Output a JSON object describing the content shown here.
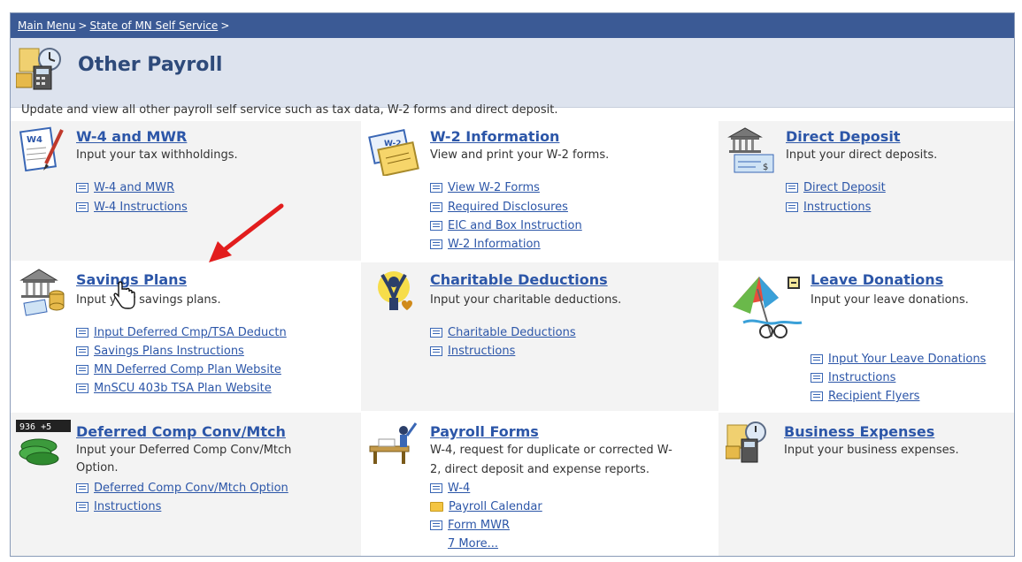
{
  "breadcrumb": {
    "main_menu": "Main Menu",
    "self_service": "State of MN Self Service",
    "sep": ">"
  },
  "page": {
    "title": "Other Payroll",
    "intro": "Update and view all other payroll self service such as tax data, W-2 forms and direct deposit."
  },
  "sections": {
    "w4": {
      "title": "W-4 and MWR",
      "description": "Input your tax withholdings.",
      "links": [
        "W-4 and MWR",
        "W-4 Instructions"
      ]
    },
    "w2": {
      "title": "W-2 Information",
      "description": "View and print your W-2 forms.",
      "links": [
        "View W-2 Forms",
        "Required Disclosures",
        "EIC and Box Instruction",
        "W-2 Information"
      ]
    },
    "direct_deposit": {
      "title": "Direct Deposit",
      "description": "Input your direct deposits.",
      "links": [
        "Direct Deposit",
        "Instructions"
      ]
    },
    "savings": {
      "title": "Savings Plans",
      "description": "Input your savings plans.",
      "links": [
        "Input Deferred Cmp/TSA Deductn",
        "Savings Plans Instructions",
        "MN Deferred Comp Plan Website",
        "MnSCU 403b TSA Plan Website"
      ]
    },
    "charitable": {
      "title": "Charitable Deductions",
      "description": "Input your charitable deductions.",
      "links": [
        "Charitable Deductions",
        "Instructions"
      ]
    },
    "leave": {
      "title": "Leave Donations",
      "description": "Input your leave donations.",
      "links": [
        "Input Your Leave Donations",
        "Instructions",
        "Recipient Flyers"
      ]
    },
    "deferred": {
      "title": "Deferred Comp Conv/Mtch",
      "description_l1": "Input your Deferred Comp Conv/Mtch",
      "description_l2": "Option.",
      "links": [
        "Deferred Comp Conv/Mtch Option",
        "Instructions"
      ]
    },
    "payroll_forms": {
      "title": "Payroll Forms",
      "description_l1": "W-4, request for duplicate or corrected W-",
      "description_l2": "2, direct deposit and expense reports.",
      "links": [
        "W-4",
        "Payroll Calendar",
        "Form MWR"
      ],
      "more": "7 More..."
    },
    "business": {
      "title": "Business Expenses",
      "description": "Input your business expenses."
    }
  },
  "colors": {
    "header": "#3b5a95",
    "title_band": "#dde3ee",
    "link": "#2c56a8",
    "arrow": "#e21d1d",
    "cell_bg": "#f3f3f3"
  }
}
